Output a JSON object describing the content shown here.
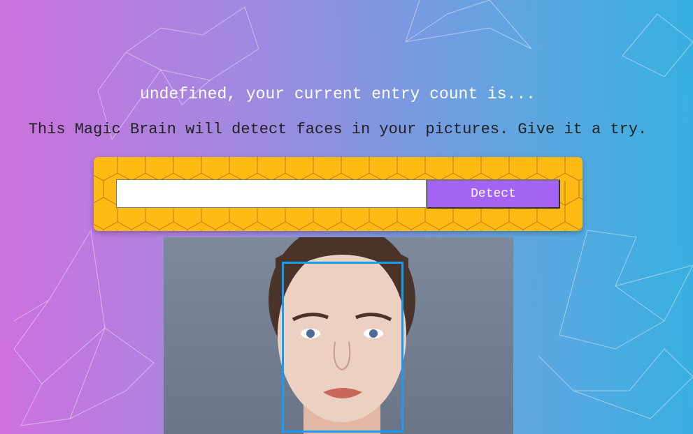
{
  "header": {
    "greeting": "undefined, your current entry count is...",
    "description": "This Magic Brain will detect faces in your pictures. Give it a try."
  },
  "form": {
    "url_value": "",
    "url_placeholder": "",
    "detect_label": "Detect"
  },
  "colors": {
    "form_bg": "#ffbb14",
    "button": "#a463f2",
    "face_box": "#149df2"
  },
  "image": {
    "subject": "face-photo"
  }
}
